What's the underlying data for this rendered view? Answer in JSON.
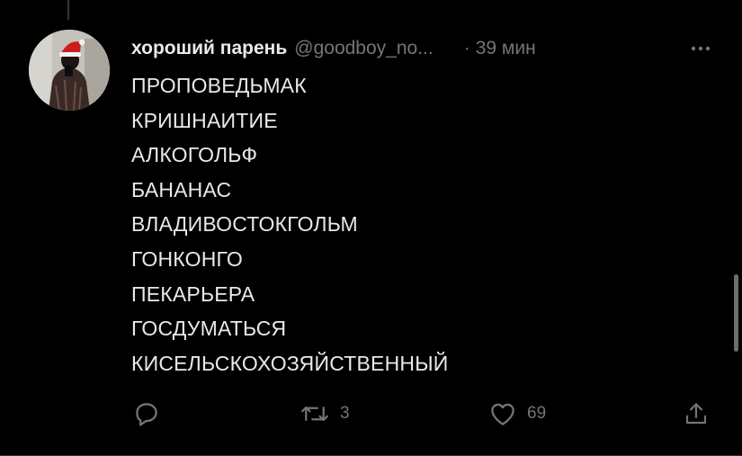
{
  "tweet": {
    "display_name": "хороший парень",
    "handle": "@goodboy_no...",
    "separator": "·",
    "time": "39 мин",
    "lines": [
      "ПРОПОВЕДЬМАК",
      "КРИШНАИТИЕ",
      "АЛКОГОЛЬФ",
      "БАНАНАС",
      "ВЛАДИВОСТОКГОЛЬМ",
      "ГОНКОНГО",
      "ПЕКАРЬЕРА",
      "ГОСДУМАТЬСЯ",
      "КИСЕЛЬСКОХОЗЯЙСТВЕННЫЙ"
    ]
  },
  "actions": {
    "reply": {
      "icon": "reply-icon",
      "count": ""
    },
    "retweet": {
      "icon": "retweet-icon",
      "count": "3"
    },
    "like": {
      "icon": "heart-icon",
      "count": "69"
    },
    "share": {
      "icon": "share-icon",
      "count": ""
    }
  },
  "icons": {
    "more": "more-horizontal-icon",
    "avatar": "avatar"
  },
  "colors": {
    "background": "#000000",
    "text_primary": "#e7e9ea",
    "text_secondary": "#71767b",
    "divider": "#2f3336"
  }
}
